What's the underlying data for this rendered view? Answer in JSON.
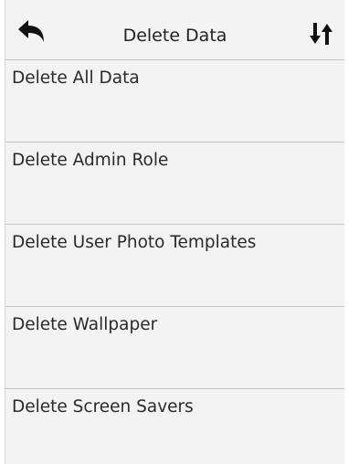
{
  "header": {
    "back_icon": "back-arrow-icon",
    "title": "Delete Data",
    "sort_icon": "sort-arrows-icon"
  },
  "list": {
    "items": [
      {
        "label": "Delete All Data"
      },
      {
        "label": "Delete Admin Role"
      },
      {
        "label": "Delete User Photo Templates"
      },
      {
        "label": "Delete Wallpaper"
      },
      {
        "label": "Delete Screen Savers"
      }
    ]
  },
  "colors": {
    "background": "#f3f3f3",
    "divider": "#c4c4c4",
    "text": "#2a2a2a"
  }
}
